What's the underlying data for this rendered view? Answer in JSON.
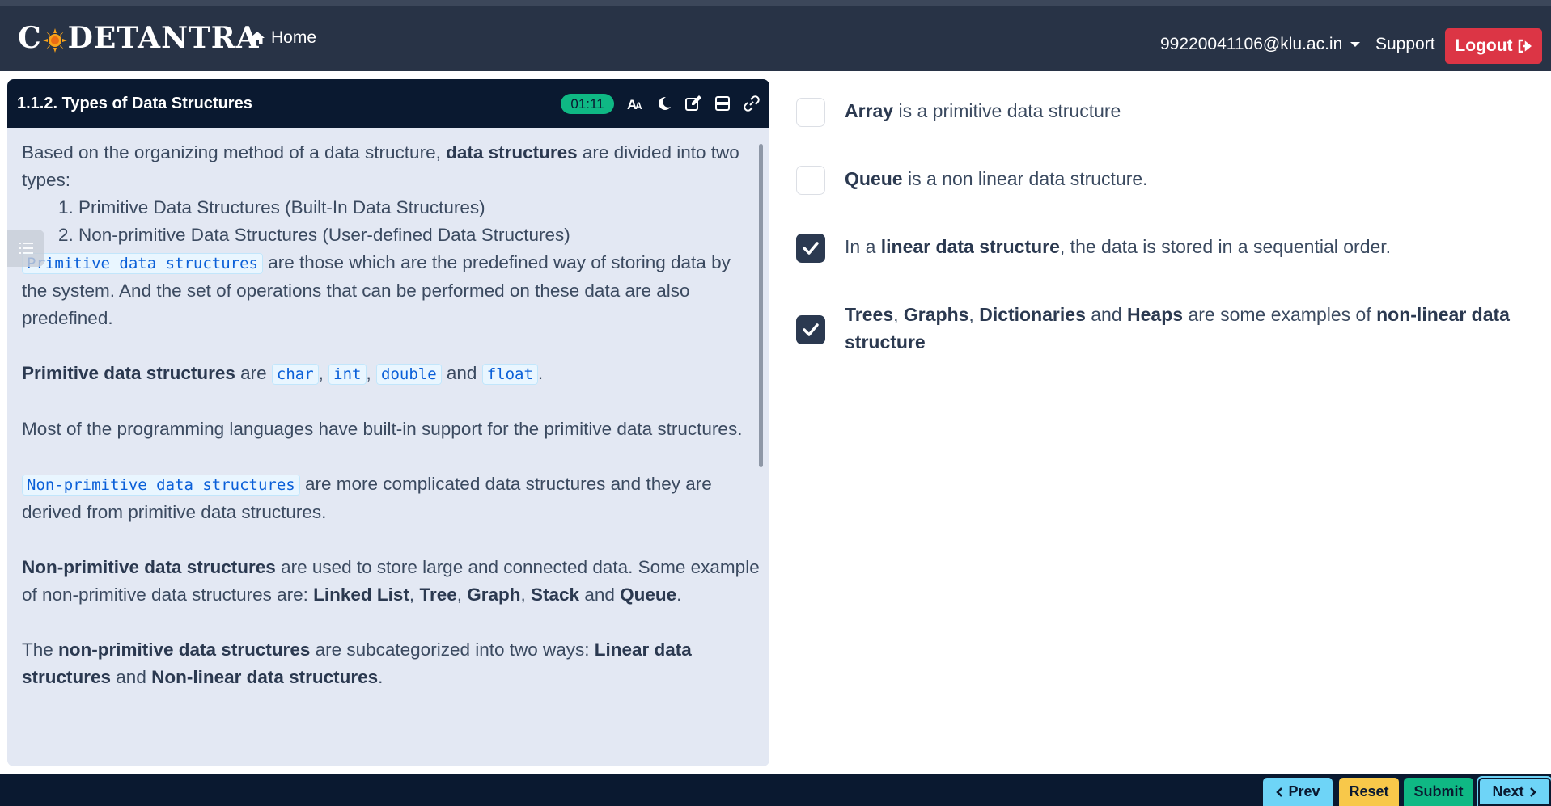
{
  "header": {
    "brand_pre": "C",
    "brand_post": "DETANTRA",
    "home_label": "Home",
    "user_email": "99220041106@klu.ac.in",
    "support_label": "Support",
    "logout_label": "Logout"
  },
  "lesson": {
    "title": "1.1.2. Types of Data Structures",
    "timer": "01:11",
    "icons": [
      "font-size-icon",
      "dark-mode-icon",
      "edit-icon",
      "layout-icon",
      "link-icon"
    ],
    "p1_a": "Based on the organizing method of a data structure, ",
    "p1_b": "data structures",
    "p1_c": " are divided into two types:",
    "list": [
      "1. Primitive Data Structures (Built-In Data Structures)",
      "2. Non-primitive Data Structures (User-defined Data Structures)"
    ],
    "p2_code": "Primitive data structures",
    "p2_rest": " are those which are the predefined way of storing data by the system. And the set of operations that can be performed on these data are also predefined.",
    "p3_b": "Primitive data structures",
    "p3_are": " are ",
    "p3_types": [
      "char",
      "int",
      "double",
      "float"
    ],
    "p3_and": " and ",
    "p4": "Most of the programming languages have built-in support for the primitive data structures.",
    "p5_code": "Non-primitive data structures",
    "p5_rest": " are more complicated data structures and they are derived from primitive data structures.",
    "p6_b": "Non-primitive data structures",
    "p6_rest": " are used to store large and connected data. Some example of non-primitive data structures are: ",
    "p6_items": [
      "Linked List",
      "Tree",
      "Graph",
      "Stack",
      "Queue"
    ],
    "p7_a": "The ",
    "p7_b": "non-primitive data structures",
    "p7_c": " are subcategorized into two ways: ",
    "p7_d": "Linear data structures",
    "p7_e": " and ",
    "p7_f": "Non-linear data structures"
  },
  "options": [
    {
      "checked": false,
      "b1": "Array",
      "t1": " is a primitive data structure"
    },
    {
      "checked": false,
      "b1": "Queue",
      "t1": " is a non linear data structure."
    },
    {
      "checked": true,
      "t0": "In a ",
      "b1": "linear data structure",
      "t1": ", the data is stored in a sequential order."
    },
    {
      "checked": true,
      "b1": "Trees",
      "s1": ", ",
      "b2": "Graphs",
      "s2": ", ",
      "b3": "Dictionaries",
      "s3": " and ",
      "b4": "Heaps",
      "s4": " are some examples of ",
      "b5": "non-linear data structure"
    }
  ],
  "footer": {
    "prev_label": "Prev",
    "reset_label": "Reset",
    "submit_label": "Submit",
    "next_label": "Next"
  }
}
